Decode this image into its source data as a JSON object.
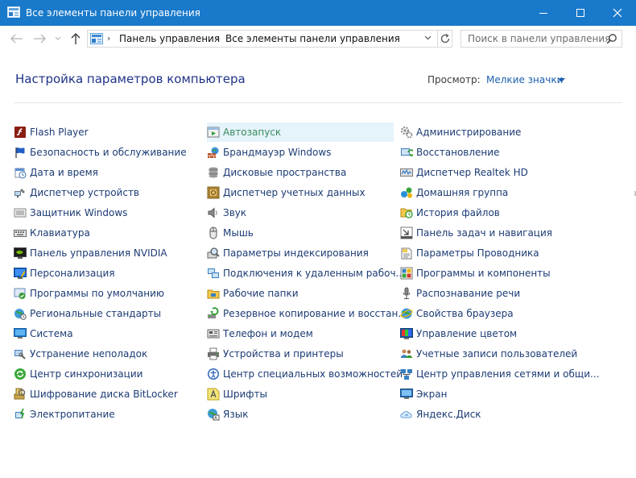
{
  "window": {
    "title": "Все элементы панели управления"
  },
  "address": {
    "crumbs": [
      "Панель управления",
      "Все элементы панели управления"
    ]
  },
  "search": {
    "placeholder": "Поиск в панели управления"
  },
  "header": {
    "title": "Настройка параметров компьютера",
    "view_label": "Просмотр:",
    "view_value": "Мелкие значки"
  },
  "columns": [
    [
      {
        "label": "Flash Player",
        "icon": "flash-player-icon"
      },
      {
        "label": "Безопасность и обслуживание",
        "icon": "flag-icon"
      },
      {
        "label": "Дата и время",
        "icon": "clock-icon"
      },
      {
        "label": "Диспетчер устройств",
        "icon": "device-manager-icon"
      },
      {
        "label": "Защитник Windows",
        "icon": "defender-icon"
      },
      {
        "label": "Клавиатура",
        "icon": "keyboard-icon"
      },
      {
        "label": "Панель управления NVIDIA",
        "icon": "nvidia-icon"
      },
      {
        "label": "Персонализация",
        "icon": "personalization-icon"
      },
      {
        "label": "Программы по умолчанию",
        "icon": "default-programs-icon"
      },
      {
        "label": "Региональные стандарты",
        "icon": "globe-clock-icon"
      },
      {
        "label": "Система",
        "icon": "monitor-icon"
      },
      {
        "label": "Устранение неполадок",
        "icon": "troubleshoot-icon"
      },
      {
        "label": "Центр синхронизации",
        "icon": "sync-icon"
      },
      {
        "label": "Шифрование диска BitLocker",
        "icon": "bitlocker-icon"
      },
      {
        "label": "Электропитание",
        "icon": "power-icon"
      }
    ],
    [
      {
        "label": "Автозапуск",
        "icon": "autoplay-icon"
      },
      {
        "label": "Брандмауэр Windows",
        "icon": "firewall-icon"
      },
      {
        "label": "Дисковые пространства",
        "icon": "storage-spaces-icon"
      },
      {
        "label": "Диспетчер учетных данных",
        "icon": "credential-vault-icon"
      },
      {
        "label": "Звук",
        "icon": "speaker-icon"
      },
      {
        "label": "Мышь",
        "icon": "mouse-icon"
      },
      {
        "label": "Параметры индексирования",
        "icon": "indexing-icon"
      },
      {
        "label": "Подключения к удаленным рабоч...",
        "icon": "remoteapp-icon"
      },
      {
        "label": "Рабочие папки",
        "icon": "work-folders-icon"
      },
      {
        "label": "Резервное копирование и восстан...",
        "icon": "backup-icon"
      },
      {
        "label": "Телефон и модем",
        "icon": "phone-modem-icon"
      },
      {
        "label": "Устройства и принтеры",
        "icon": "printer-icon"
      },
      {
        "label": "Центр специальных возможностей",
        "icon": "accessibility-icon"
      },
      {
        "label": "Шрифты",
        "icon": "fonts-icon"
      },
      {
        "label": "Язык",
        "icon": "language-icon"
      }
    ],
    [
      {
        "label": "Администрирование",
        "icon": "admin-tools-icon"
      },
      {
        "label": "Восстановление",
        "icon": "recovery-icon"
      },
      {
        "label": "Диспетчер Realtek HD",
        "icon": "realtek-icon"
      },
      {
        "label": "Домашняя группа",
        "icon": "homegroup-icon"
      },
      {
        "label": "История файлов",
        "icon": "file-history-icon"
      },
      {
        "label": "Панель задач и навигация",
        "icon": "taskbar-icon"
      },
      {
        "label": "Параметры Проводника",
        "icon": "explorer-options-icon"
      },
      {
        "label": "Программы и компоненты",
        "icon": "programs-features-icon"
      },
      {
        "label": "Распознавание речи",
        "icon": "microphone-icon"
      },
      {
        "label": "Свойства браузера",
        "icon": "internet-options-icon"
      },
      {
        "label": "Управление цветом",
        "icon": "color-management-icon"
      },
      {
        "label": "Учетные записи пользователей",
        "icon": "user-accounts-icon"
      },
      {
        "label": "Центр управления сетями и общи...",
        "icon": "network-center-icon"
      },
      {
        "label": "Экран",
        "icon": "display-icon"
      },
      {
        "label": "Яндекс.Диск",
        "icon": "yandex-disk-icon"
      }
    ]
  ],
  "highlighted_item": "Автозапуск"
}
